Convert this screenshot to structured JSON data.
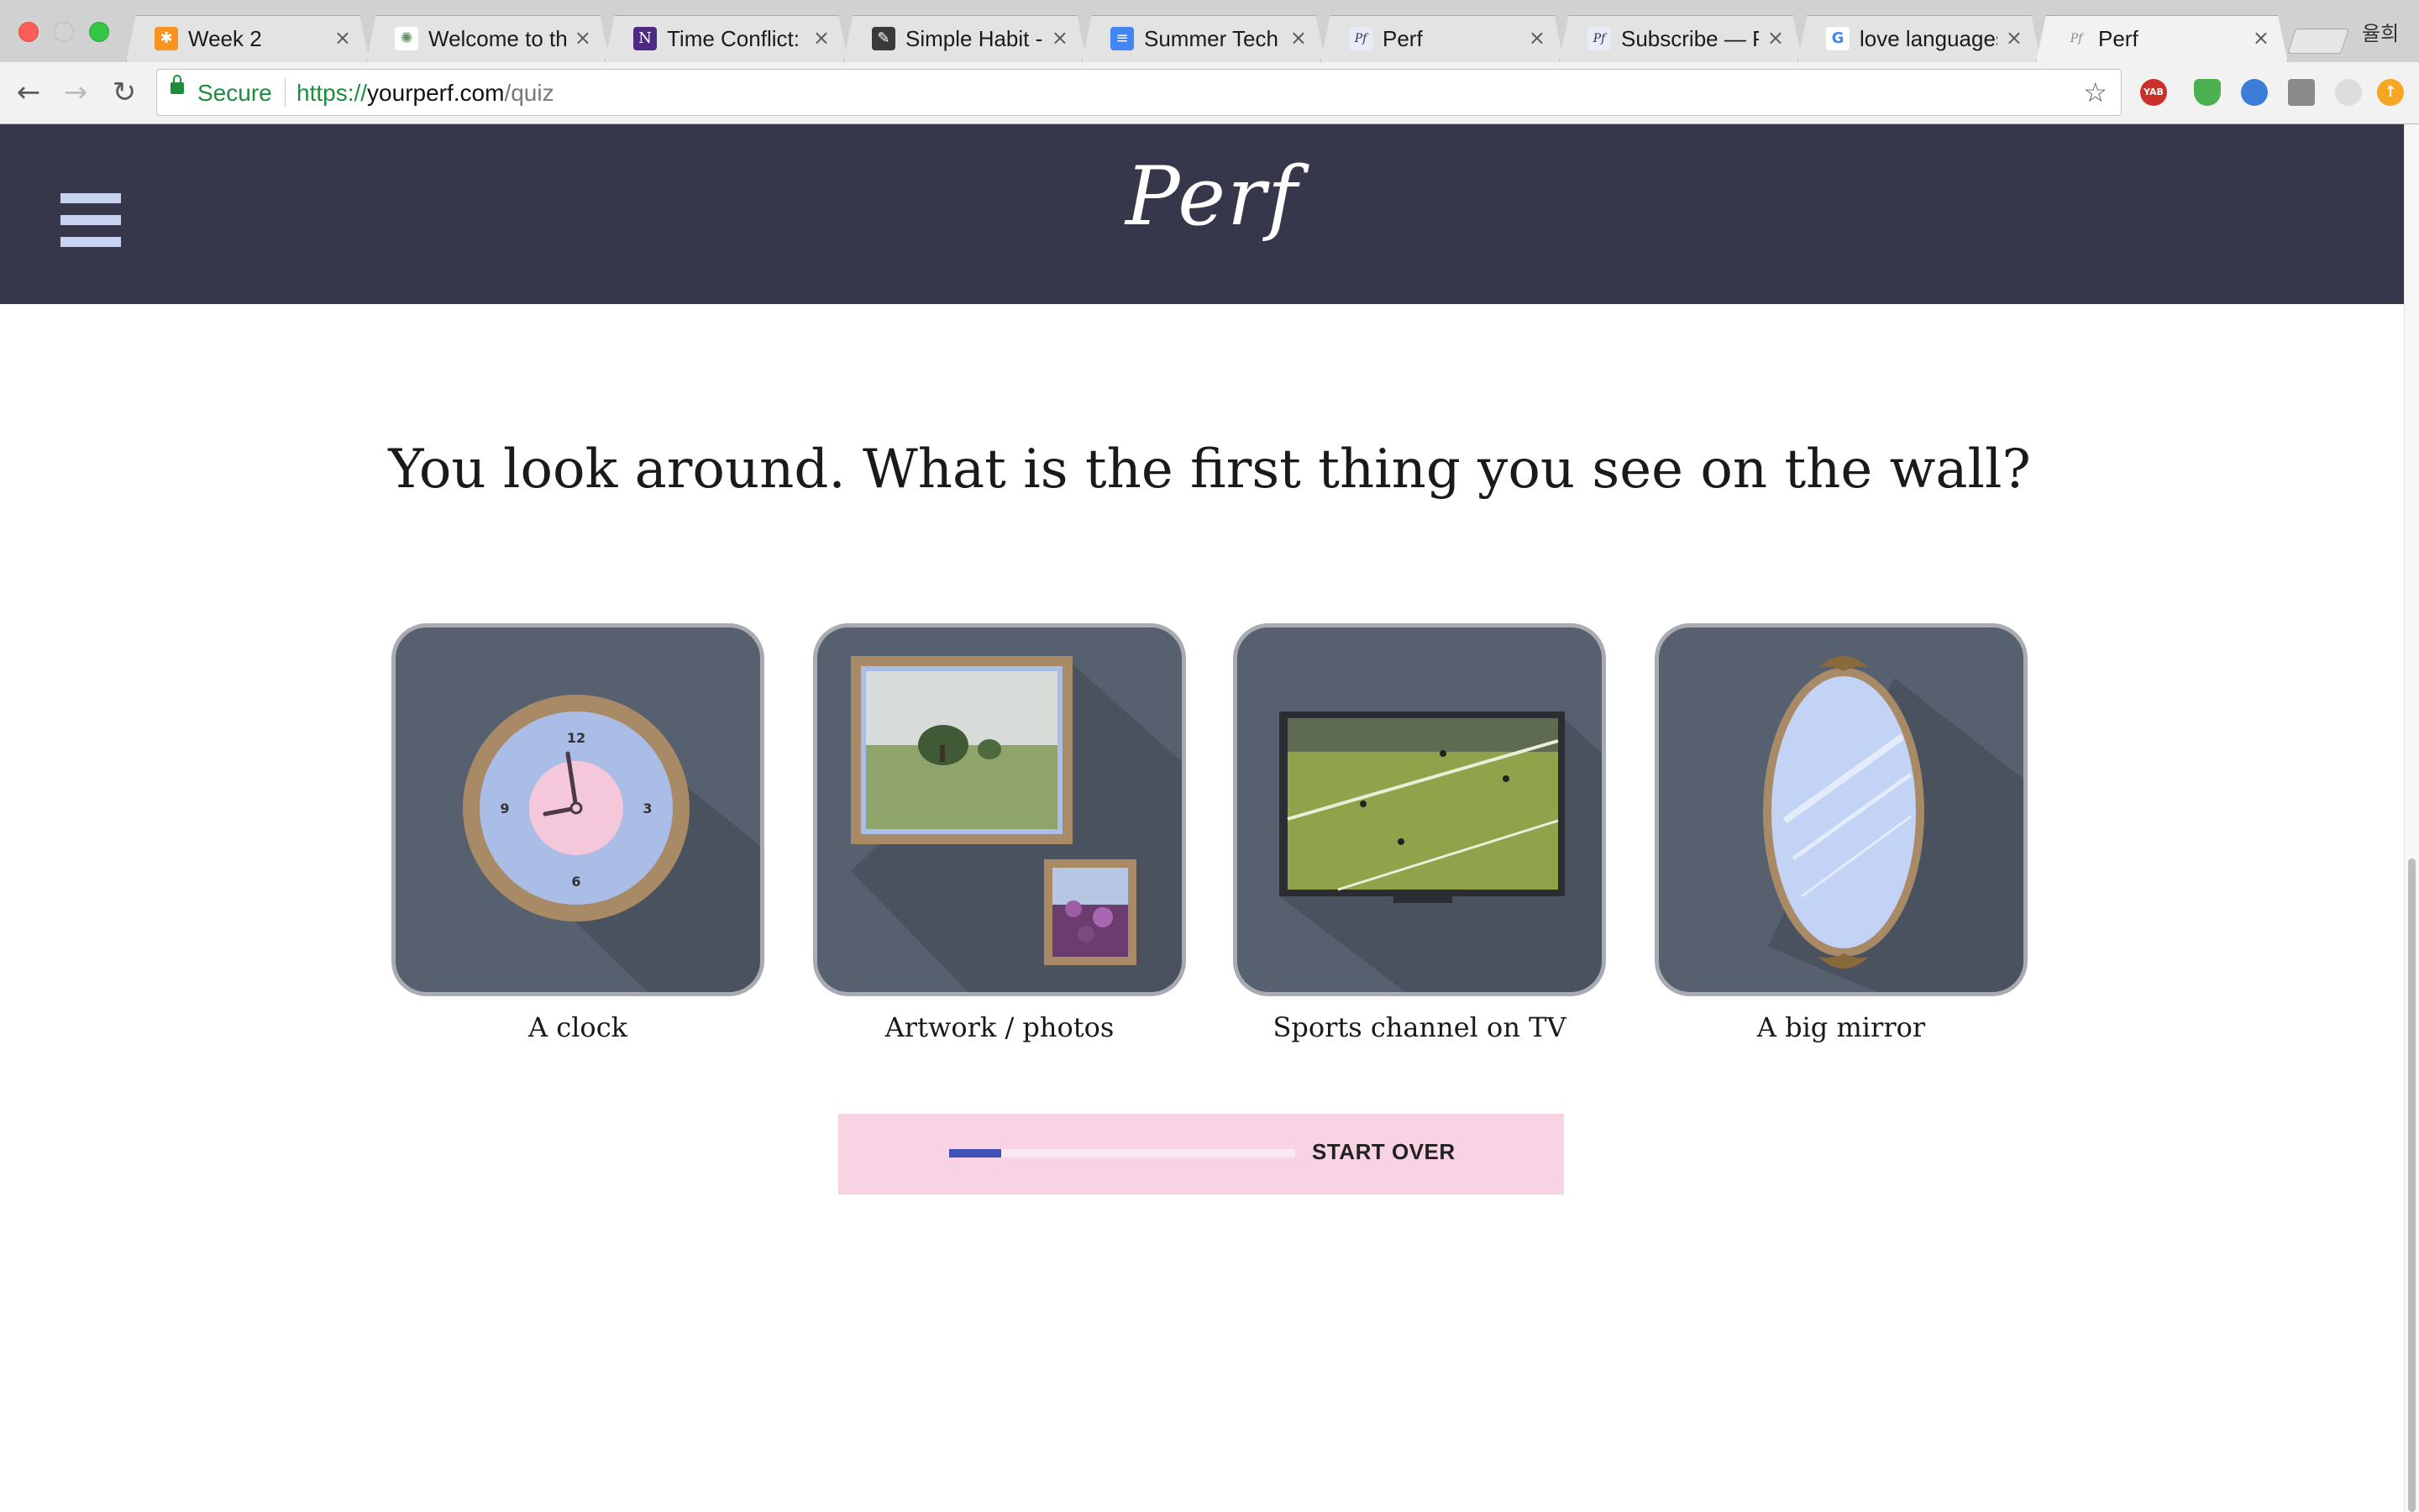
{
  "browser": {
    "tabs": [
      {
        "title": "Week 2",
        "icon": "joomla-icon"
      },
      {
        "title": "Welcome to the",
        "icon": "sunburst-icon"
      },
      {
        "title": "Time Conflict: C",
        "icon": "n-logo-icon"
      },
      {
        "title": "Simple Habit - V",
        "icon": "pen-icon"
      },
      {
        "title": "Summer Tech In",
        "icon": "docs-icon"
      },
      {
        "title": "Perf",
        "icon": "perf-favicon"
      },
      {
        "title": "Subscribe — Pe",
        "icon": "perf-favicon"
      },
      {
        "title": "love languages",
        "icon": "google-icon"
      },
      {
        "title": "Perf",
        "icon": "perf-favicon",
        "active": true
      }
    ],
    "profile_name": "율희",
    "security_label": "Secure",
    "url": {
      "scheme": "https://",
      "host": "yourperf.com",
      "path": "/quiz"
    },
    "extensions": [
      {
        "name": "yab-extension-icon",
        "label": "YAB",
        "color": "#c9302c"
      },
      {
        "name": "shield-extension-icon",
        "label": "",
        "color": "#4caf50"
      },
      {
        "name": "globe-extension-icon",
        "label": "",
        "color": "#3b7dd8"
      },
      {
        "name": "eyedropper-extension-icon",
        "label": "",
        "color": "#8a8a8a"
      },
      {
        "name": "moon-extension-icon",
        "label": "",
        "color": "#dddddd"
      },
      {
        "name": "orange-extension-icon",
        "label": "",
        "color": "#f5a623"
      }
    ]
  },
  "site": {
    "logo": "Perf",
    "menu_icon": "hamburger-menu-icon"
  },
  "quiz": {
    "question": "You look around. What is the first thing you see on the wall?",
    "options": [
      {
        "label": "A clock",
        "icon": "clock-illustration"
      },
      {
        "label": "Artwork / photos",
        "icon": "framed-photos-illustration"
      },
      {
        "label": "Sports channel on TV",
        "icon": "tv-soccer-illustration"
      },
      {
        "label": "A big mirror",
        "icon": "oval-mirror-illustration"
      }
    ],
    "clock_numbers": [
      "12",
      "3",
      "6",
      "9"
    ],
    "progress_fraction": 0.15,
    "start_over_label": "START OVER"
  },
  "colors": {
    "header_bg": "#36374a",
    "card_bg": "#57606f",
    "progress_box": "#f7d3e4",
    "progress_fill": "#3f51b5"
  }
}
